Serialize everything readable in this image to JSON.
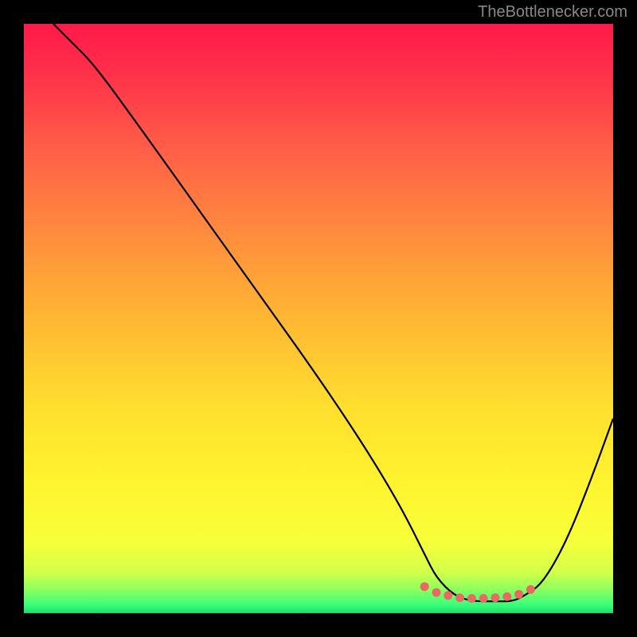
{
  "attribution": "TheBottlenecker.com",
  "chart_data": {
    "type": "line",
    "title": "",
    "xlabel": "",
    "ylabel": "",
    "xlim": [
      0,
      100
    ],
    "ylim": [
      0,
      100
    ],
    "series": [
      {
        "name": "curve",
        "x": [
          5,
          8,
          12,
          20,
          30,
          40,
          50,
          58,
          64,
          68,
          70,
          73,
          76,
          80,
          83,
          85,
          88,
          92,
          96,
          100
        ],
        "values": [
          100,
          97,
          93,
          82,
          68,
          54,
          40,
          28,
          18,
          10,
          6,
          3,
          2,
          2,
          2,
          3,
          5,
          12,
          22,
          33
        ]
      }
    ],
    "markers": {
      "x": [
        68,
        70,
        72,
        74,
        76,
        78,
        80,
        82,
        84,
        86
      ],
      "values": [
        4.5,
        3.5,
        3.0,
        2.6,
        2.5,
        2.5,
        2.6,
        2.8,
        3.2,
        4.0
      ],
      "color": "#e96a63"
    },
    "gradient_stops": [
      {
        "offset": 0,
        "color": "#ff1a4a"
      },
      {
        "offset": 0.08,
        "color": "#ff2f4a"
      },
      {
        "offset": 0.2,
        "color": "#ff5a48"
      },
      {
        "offset": 0.35,
        "color": "#ff8a3e"
      },
      {
        "offset": 0.5,
        "color": "#ffb733"
      },
      {
        "offset": 0.65,
        "color": "#ffdf2e"
      },
      {
        "offset": 0.78,
        "color": "#fff42f"
      },
      {
        "offset": 0.88,
        "color": "#f6ff3a"
      },
      {
        "offset": 0.93,
        "color": "#d3ff4a"
      },
      {
        "offset": 0.96,
        "color": "#8cff5e"
      },
      {
        "offset": 0.985,
        "color": "#3dff7a"
      },
      {
        "offset": 1.0,
        "color": "#16e06a"
      }
    ]
  }
}
